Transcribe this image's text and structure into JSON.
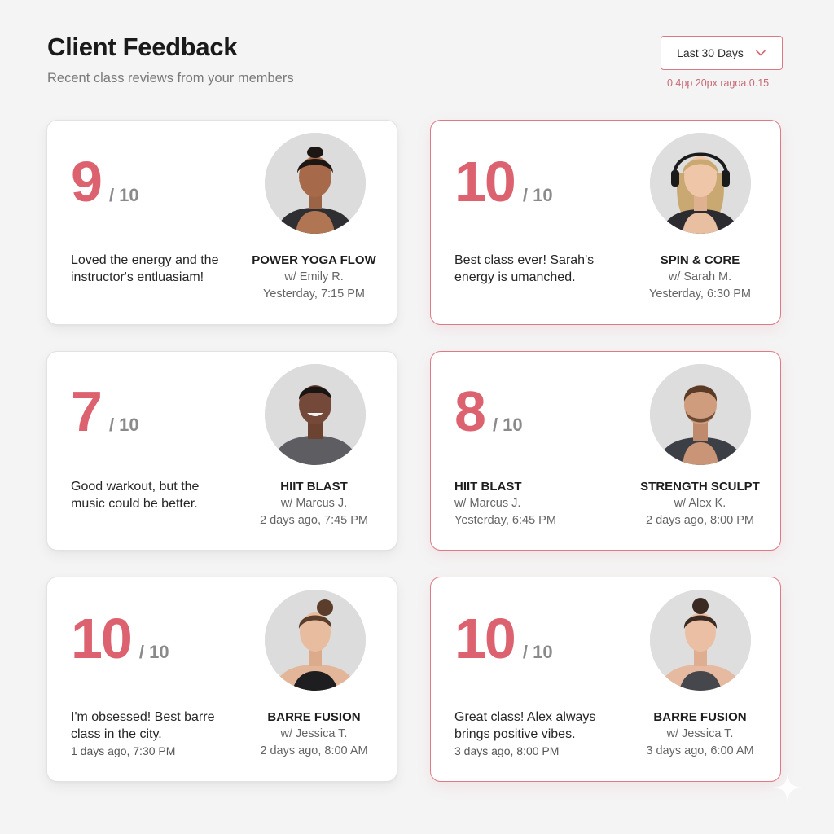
{
  "header": {
    "title": "Client Feedback",
    "subtitle": "Recent class reviews from your members"
  },
  "filter": {
    "selected": "Last 30 Days",
    "note": "0 4pp 20px ragoa.0.15"
  },
  "colors": {
    "accent": "#dd6270",
    "accent_border": "#de7a87",
    "card_bg": "#ffffff",
    "page_bg": "#f4f4f4"
  },
  "cards": [
    {
      "score": "9",
      "scale": "/ 10",
      "comment": "Loved the energy and the instructor's entluasiam!",
      "comment_time": "",
      "class_name": "POWER YOGA FLOW",
      "instructor": "w/ Emily R.",
      "time": "Yesterday, 7:15 PM",
      "highlighted": false
    },
    {
      "score": "10",
      "scale": "/ 10",
      "comment": "Best class ever! Sarah's energy is umanched.",
      "comment_time": "",
      "class_name": "SPIN & CORE",
      "instructor": "w/ Sarah M.",
      "time": "Yesterday, 6:30 PM",
      "highlighted": true
    },
    {
      "score": "7",
      "scale": "/ 10",
      "comment": "Good warkout, but the music could be better.",
      "comment_time": "",
      "class_name": "HIIT BLAST",
      "instructor": "w/ Marcus J.",
      "time": "2 days ago, 7:45 PM",
      "highlighted": false
    },
    {
      "score": "8",
      "scale": "/ 10",
      "comment_class": "HIIT BLAST",
      "comment_instructor": "w/ Marcus J.",
      "comment_time": "Yesterday, 6:45 PM",
      "class_name": "STRENGTH SCULPT",
      "instructor": "w/ Alex K.",
      "time": "2 days ago, 8:00 PM",
      "highlighted": true
    },
    {
      "score": "10",
      "scale": "/ 10",
      "comment": "I'm obsessed! Best barre class in the city.",
      "comment_time": "1 days ago, 7:30 PM",
      "class_name": "BARRE FUSION",
      "instructor": "w/ Jessica T.",
      "time": "2 days ago, 8:00 AM",
      "highlighted": false
    },
    {
      "score": "10",
      "scale": "/ 10",
      "comment": "Great class! Alex always brings positive vibes.",
      "comment_time": "3 days ago, 8:00 PM",
      "class_name": "BARRE FUSION",
      "instructor": "w/ Jessica T.",
      "time": "3 days ago, 6:00 AM",
      "highlighted": true
    }
  ]
}
